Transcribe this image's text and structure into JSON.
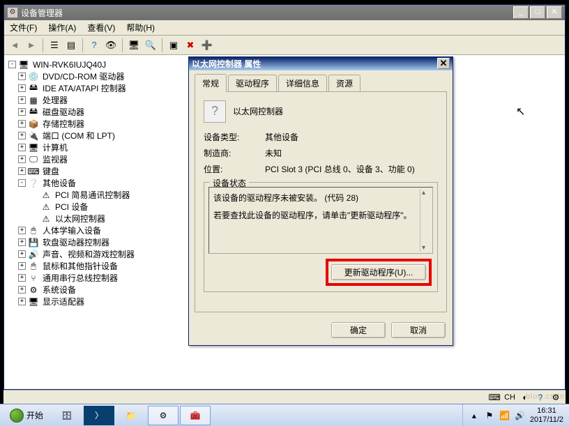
{
  "window": {
    "title": "设备管理器",
    "menu": {
      "file": "文件(F)",
      "action": "操作(A)",
      "view": "查看(V)",
      "help": "帮助(H)"
    }
  },
  "toolbar_icons": {
    "back": "back-icon",
    "fwd": "forward-icon",
    "up": "up-icon",
    "show": "show-hidden-icon",
    "prop": "properties-icon",
    "refresh": "refresh-icon",
    "help": "help-icon",
    "print": "print-icon",
    "delete": "delete-icon",
    "scan": "scan-icon",
    "add": "add-hw-icon"
  },
  "tree": {
    "root": "WIN-RVK6IUJQ40J",
    "nodes": [
      {
        "label": "DVD/CD-ROM 驱动器",
        "icon": "disc-icon"
      },
      {
        "label": "IDE ATA/ATAPI 控制器",
        "icon": "ide-icon"
      },
      {
        "label": "处理器",
        "icon": "cpu-icon"
      },
      {
        "label": "磁盘驱动器",
        "icon": "hdd-icon"
      },
      {
        "label": "存储控制器",
        "icon": "storage-icon"
      },
      {
        "label": "端口 (COM 和 LPT)",
        "icon": "port-icon"
      },
      {
        "label": "计算机",
        "icon": "computer-icon"
      },
      {
        "label": "监视器",
        "icon": "monitor-icon"
      },
      {
        "label": "键盘",
        "icon": "keyboard-icon"
      }
    ],
    "other_devices": {
      "label": "其他设备",
      "icon": "unknown-icon",
      "children": [
        {
          "label": "PCI 简易通讯控制器",
          "icon": "warn-icon"
        },
        {
          "label": "PCI 设备",
          "icon": "warn-icon"
        },
        {
          "label": "以太网控制器",
          "icon": "warn-icon"
        }
      ]
    },
    "rest": [
      {
        "label": "人体学输入设备",
        "icon": "hid-icon"
      },
      {
        "label": "软盘驱动器控制器",
        "icon": "floppy-icon"
      },
      {
        "label": "声音、视频和游戏控制器",
        "icon": "sound-icon"
      },
      {
        "label": "鼠标和其他指针设备",
        "icon": "mouse-icon"
      },
      {
        "label": "通用串行总线控制器",
        "icon": "usb-icon"
      },
      {
        "label": "系统设备",
        "icon": "system-icon"
      },
      {
        "label": "显示适配器",
        "icon": "display-icon"
      }
    ]
  },
  "dialog": {
    "title": "以太网控制器 属性",
    "tabs": {
      "general": "常规",
      "driver": "驱动程序",
      "details": "详细信息",
      "resources": "资源"
    },
    "device_name": "以太网控制器",
    "labels": {
      "type": "设备类型:",
      "mfr": "制造商:",
      "loc": "位置:"
    },
    "type": "其他设备",
    "mfr": "未知",
    "loc": "PCI Slot 3 (PCI 总线 0、设备 3、功能 0)",
    "status_legend": "设备状态",
    "status_line1": "该设备的驱动程序未被安装。 (代码 28)",
    "status_line2": "若要查找此设备的驱动程序，请单击\"更新驱动程序\"。",
    "update_btn": "更新驱动程序(U)...",
    "ok": "确定",
    "cancel": "取消"
  },
  "statusbar": {
    "lang": "CH"
  },
  "taskbar": {
    "start": "开始",
    "clock_time": "16:31",
    "clock_date": "2017/11/2"
  },
  "watermark": "blog.csdn"
}
